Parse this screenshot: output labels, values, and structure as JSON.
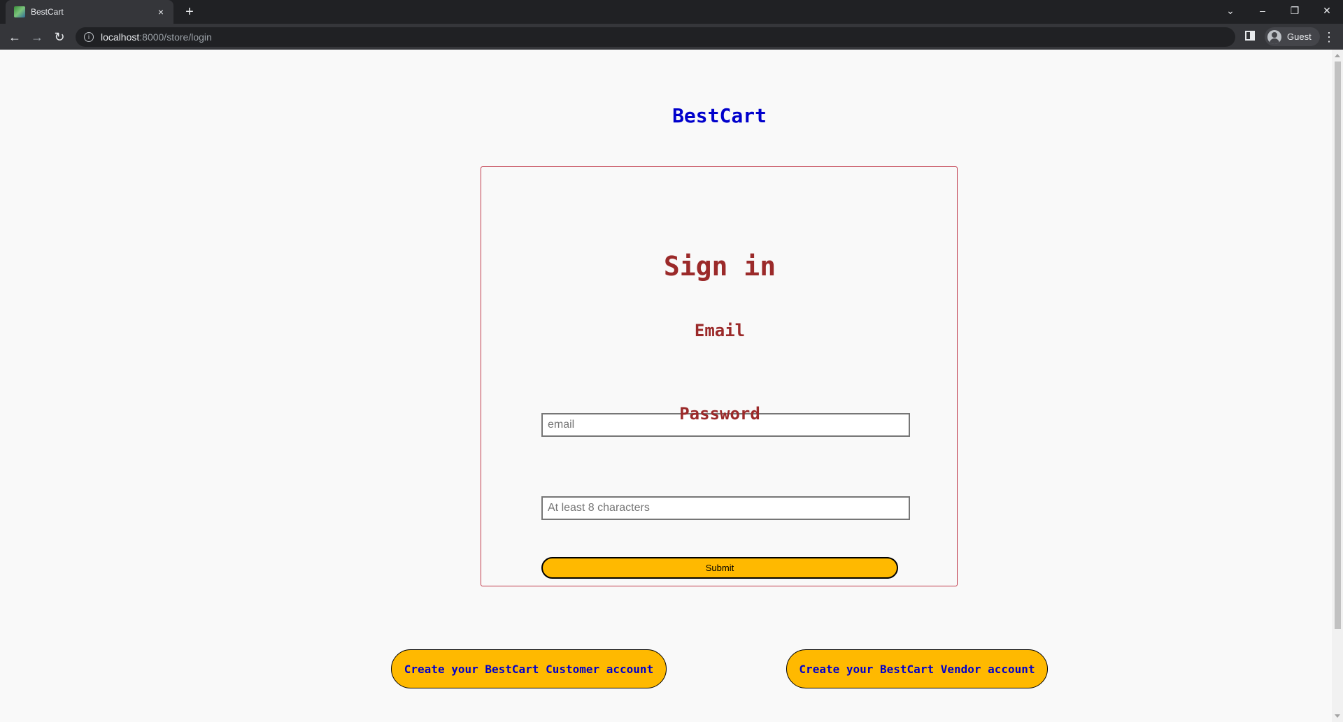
{
  "browser": {
    "tab_title": "BestCart",
    "tab_close": "×",
    "new_tab": "+",
    "url_host": "localhost",
    "url_rest": ":8000/store/login",
    "profile_label": "Guest"
  },
  "page": {
    "brand": "BestCart",
    "heading": "Sign in",
    "email_label": "Email",
    "email_placeholder": "email",
    "password_label": "Password",
    "password_placeholder": "At least 8 characters",
    "submit_label": "Submit",
    "customer_account_label": "Create your BestCart Customer account",
    "vendor_account_label": "Create your BestCart Vendor account"
  },
  "colors": {
    "brand": "#0000cc",
    "heading": "#9b2a2a",
    "card_border": "#c0394a",
    "button": "#ffb900"
  }
}
